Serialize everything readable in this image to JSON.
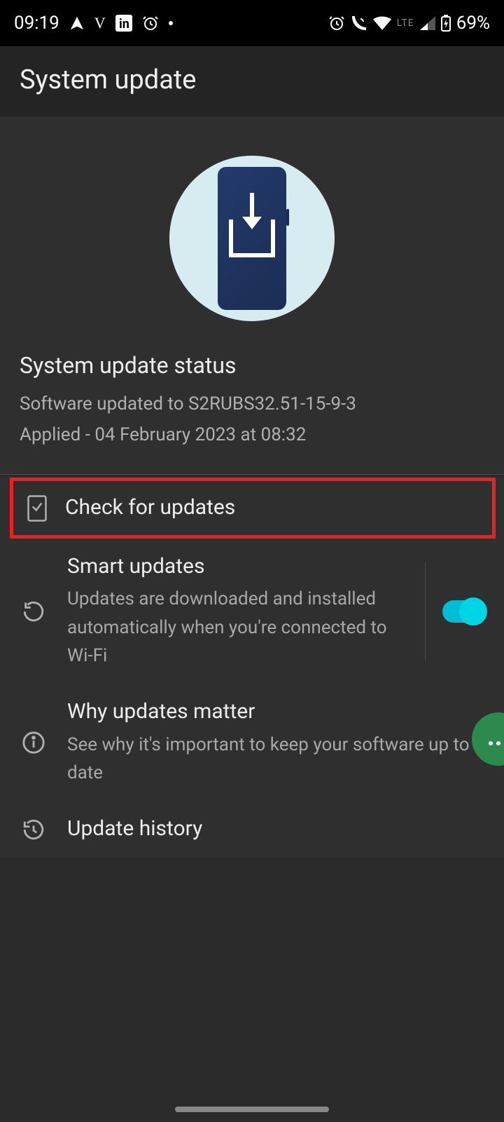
{
  "status_bar": {
    "time": "09:19",
    "battery_text": "69%",
    "lte_label": "LTE",
    "v_label": "V"
  },
  "header": {
    "title": "System update"
  },
  "status_block": {
    "title": "System update status",
    "software_line": "Software updated to S2RUBS32.51-15-9-3",
    "applied_line": "Applied - 04 February 2023 at 08:32"
  },
  "menu": {
    "check_updates": {
      "label": "Check for updates"
    },
    "smart_updates": {
      "label": "Smart updates",
      "desc": "Updates are downloaded and installed automatically when you're connected to Wi-Fi",
      "toggle_on": true
    },
    "why_matter": {
      "label": "Why updates matter",
      "desc": "See why it's important to keep your software up to date"
    },
    "history": {
      "label": "Update history"
    }
  }
}
